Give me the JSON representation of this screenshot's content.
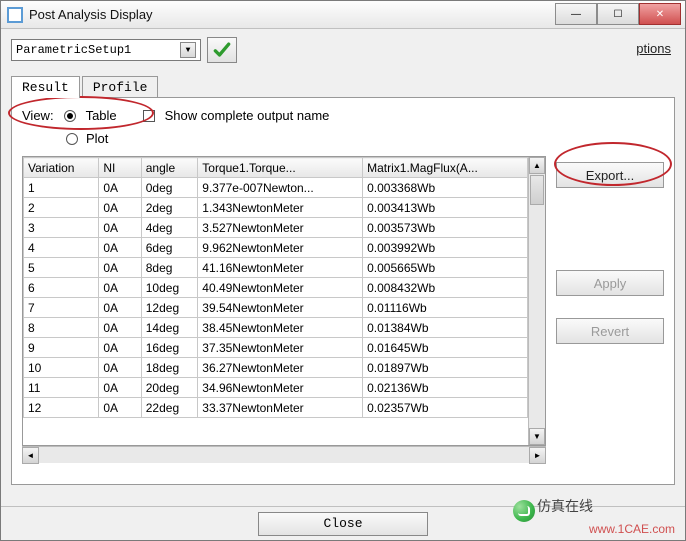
{
  "window": {
    "title": "Post Analysis Display",
    "options_label": "ptions"
  },
  "toolbar": {
    "setup_selected": "ParametricSetup1"
  },
  "tabs": {
    "result": "Result",
    "profile": "Profile"
  },
  "view": {
    "label": "View:",
    "table": "Table",
    "plot": "Plot",
    "show_complete": "Show complete output name"
  },
  "buttons": {
    "export": "Export...",
    "apply": "Apply",
    "revert": "Revert",
    "close": "Close"
  },
  "table": {
    "headers": {
      "variation": "Variation",
      "ni": "NI",
      "angle": "angle",
      "torque": "Torque1.Torque...",
      "flux": "Matrix1.MagFlux(A..."
    },
    "rows": [
      {
        "variation": "1",
        "ni": "0A",
        "angle": "0deg",
        "torque": "9.377e-007Newton...",
        "flux": "0.003368Wb"
      },
      {
        "variation": "2",
        "ni": "0A",
        "angle": "2deg",
        "torque": "1.343NewtonMeter",
        "flux": "0.003413Wb"
      },
      {
        "variation": "3",
        "ni": "0A",
        "angle": "4deg",
        "torque": "3.527NewtonMeter",
        "flux": "0.003573Wb"
      },
      {
        "variation": "4",
        "ni": "0A",
        "angle": "6deg",
        "torque": "9.962NewtonMeter",
        "flux": "0.003992Wb"
      },
      {
        "variation": "5",
        "ni": "0A",
        "angle": "8deg",
        "torque": "41.16NewtonMeter",
        "flux": "0.005665Wb"
      },
      {
        "variation": "6",
        "ni": "0A",
        "angle": "10deg",
        "torque": "40.49NewtonMeter",
        "flux": "0.008432Wb"
      },
      {
        "variation": "7",
        "ni": "0A",
        "angle": "12deg",
        "torque": "39.54NewtonMeter",
        "flux": "0.01116Wb"
      },
      {
        "variation": "8",
        "ni": "0A",
        "angle": "14deg",
        "torque": "38.45NewtonMeter",
        "flux": "0.01384Wb"
      },
      {
        "variation": "9",
        "ni": "0A",
        "angle": "16deg",
        "torque": "37.35NewtonMeter",
        "flux": "0.01645Wb"
      },
      {
        "variation": "10",
        "ni": "0A",
        "angle": "18deg",
        "torque": "36.27NewtonMeter",
        "flux": "0.01897Wb"
      },
      {
        "variation": "11",
        "ni": "0A",
        "angle": "20deg",
        "torque": "34.96NewtonMeter",
        "flux": "0.02136Wb"
      },
      {
        "variation": "12",
        "ni": "0A",
        "angle": "22deg",
        "torque": "33.37NewtonMeter",
        "flux": "0.02357Wb"
      }
    ]
  },
  "watermark": {
    "brand": "仿真在线",
    "url": "www.1CAE.com"
  }
}
